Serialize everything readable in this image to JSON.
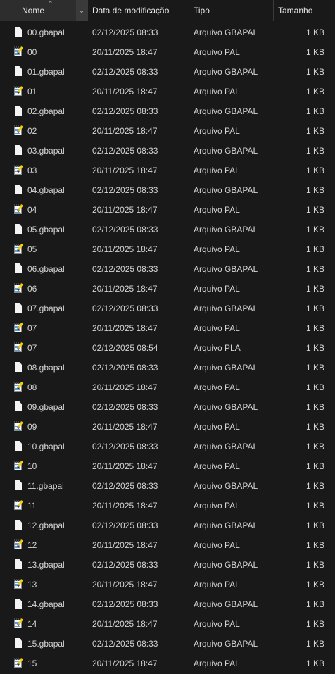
{
  "columns": {
    "name": "Nome",
    "date": "Data de modificação",
    "type": "Tipo",
    "size": "Tamanho"
  },
  "icons": {
    "sort": "chevron-up-icon",
    "dropdown": "chevron-down-icon",
    "gbapal": "document-icon",
    "pal": "notepad-icon"
  },
  "rows": [
    {
      "name": "00.gbapal",
      "date": "02/12/2025 08:33",
      "type": "Arquivo GBAPAL",
      "size": "1 KB",
      "icon": "doc"
    },
    {
      "name": "00",
      "date": "20/11/2025 18:47",
      "type": "Arquivo PAL",
      "size": "1 KB",
      "icon": "note"
    },
    {
      "name": "01.gbapal",
      "date": "02/12/2025 08:33",
      "type": "Arquivo GBAPAL",
      "size": "1 KB",
      "icon": "doc"
    },
    {
      "name": "01",
      "date": "20/11/2025 18:47",
      "type": "Arquivo PAL",
      "size": "1 KB",
      "icon": "note"
    },
    {
      "name": "02.gbapal",
      "date": "02/12/2025 08:33",
      "type": "Arquivo GBAPAL",
      "size": "1 KB",
      "icon": "doc"
    },
    {
      "name": "02",
      "date": "20/11/2025 18:47",
      "type": "Arquivo PAL",
      "size": "1 KB",
      "icon": "note"
    },
    {
      "name": "03.gbapal",
      "date": "02/12/2025 08:33",
      "type": "Arquivo GBAPAL",
      "size": "1 KB",
      "icon": "doc"
    },
    {
      "name": "03",
      "date": "20/11/2025 18:47",
      "type": "Arquivo PAL",
      "size": "1 KB",
      "icon": "note"
    },
    {
      "name": "04.gbapal",
      "date": "02/12/2025 08:33",
      "type": "Arquivo GBAPAL",
      "size": "1 KB",
      "icon": "doc"
    },
    {
      "name": "04",
      "date": "20/11/2025 18:47",
      "type": "Arquivo PAL",
      "size": "1 KB",
      "icon": "note"
    },
    {
      "name": "05.gbapal",
      "date": "02/12/2025 08:33",
      "type": "Arquivo GBAPAL",
      "size": "1 KB",
      "icon": "doc"
    },
    {
      "name": "05",
      "date": "20/11/2025 18:47",
      "type": "Arquivo PAL",
      "size": "1 KB",
      "icon": "note"
    },
    {
      "name": "06.gbapal",
      "date": "02/12/2025 08:33",
      "type": "Arquivo GBAPAL",
      "size": "1 KB",
      "icon": "doc"
    },
    {
      "name": "06",
      "date": "20/11/2025 18:47",
      "type": "Arquivo PAL",
      "size": "1 KB",
      "icon": "note"
    },
    {
      "name": "07.gbapal",
      "date": "02/12/2025 08:33",
      "type": "Arquivo GBAPAL",
      "size": "1 KB",
      "icon": "doc"
    },
    {
      "name": "07",
      "date": "20/11/2025 18:47",
      "type": "Arquivo PAL",
      "size": "1 KB",
      "icon": "note"
    },
    {
      "name": "07",
      "date": "02/12/2025 08:54",
      "type": "Arquivo PLA",
      "size": "1 KB",
      "icon": "note"
    },
    {
      "name": "08.gbapal",
      "date": "02/12/2025 08:33",
      "type": "Arquivo GBAPAL",
      "size": "1 KB",
      "icon": "doc"
    },
    {
      "name": "08",
      "date": "20/11/2025 18:47",
      "type": "Arquivo PAL",
      "size": "1 KB",
      "icon": "note"
    },
    {
      "name": "09.gbapal",
      "date": "02/12/2025 08:33",
      "type": "Arquivo GBAPAL",
      "size": "1 KB",
      "icon": "doc"
    },
    {
      "name": "09",
      "date": "20/11/2025 18:47",
      "type": "Arquivo PAL",
      "size": "1 KB",
      "icon": "note"
    },
    {
      "name": "10.gbapal",
      "date": "02/12/2025 08:33",
      "type": "Arquivo GBAPAL",
      "size": "1 KB",
      "icon": "doc"
    },
    {
      "name": "10",
      "date": "20/11/2025 18:47",
      "type": "Arquivo PAL",
      "size": "1 KB",
      "icon": "note"
    },
    {
      "name": "11.gbapal",
      "date": "02/12/2025 08:33",
      "type": "Arquivo GBAPAL",
      "size": "1 KB",
      "icon": "doc"
    },
    {
      "name": "11",
      "date": "20/11/2025 18:47",
      "type": "Arquivo PAL",
      "size": "1 KB",
      "icon": "note"
    },
    {
      "name": "12.gbapal",
      "date": "02/12/2025 08:33",
      "type": "Arquivo GBAPAL",
      "size": "1 KB",
      "icon": "doc"
    },
    {
      "name": "12",
      "date": "20/11/2025 18:47",
      "type": "Arquivo PAL",
      "size": "1 KB",
      "icon": "note"
    },
    {
      "name": "13.gbapal",
      "date": "02/12/2025 08:33",
      "type": "Arquivo GBAPAL",
      "size": "1 KB",
      "icon": "doc"
    },
    {
      "name": "13",
      "date": "20/11/2025 18:47",
      "type": "Arquivo PAL",
      "size": "1 KB",
      "icon": "note"
    },
    {
      "name": "14.gbapal",
      "date": "02/12/2025 08:33",
      "type": "Arquivo GBAPAL",
      "size": "1 KB",
      "icon": "doc"
    },
    {
      "name": "14",
      "date": "20/11/2025 18:47",
      "type": "Arquivo PAL",
      "size": "1 KB",
      "icon": "note"
    },
    {
      "name": "15.gbapal",
      "date": "02/12/2025 08:33",
      "type": "Arquivo GBAPAL",
      "size": "1 KB",
      "icon": "doc"
    },
    {
      "name": "15",
      "date": "20/11/2025 18:47",
      "type": "Arquivo PAL",
      "size": "1 KB",
      "icon": "note"
    }
  ]
}
